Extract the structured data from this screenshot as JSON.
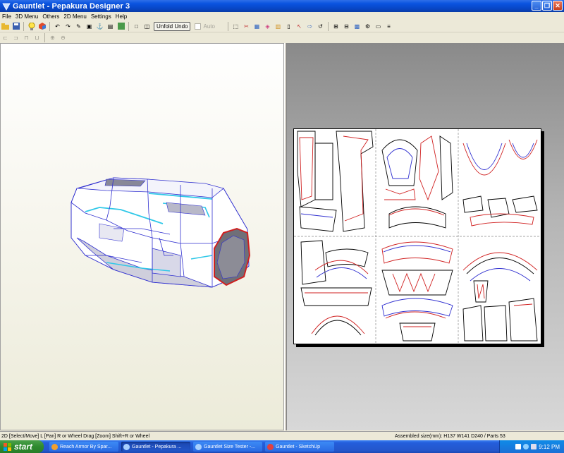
{
  "window": {
    "title": "Gauntlet - Pepakura Designer 3"
  },
  "menu": {
    "items": [
      "File",
      "3D Menu",
      "Others",
      "2D Menu",
      "Settings",
      "Help"
    ]
  },
  "toolbar": {
    "unfold_undo_label": "Unfold Undo",
    "auto_label": "Auto"
  },
  "status": {
    "left": "2D [Select/Move] L [Pan] R or Wheel Drag [Zoom] Shift+R or Wheel",
    "right": "Assembled size(mm): H137 W141 D240 / Parts 53"
  },
  "taskbar": {
    "start_label": "start",
    "tasks": [
      {
        "label": "Reach Armor By Spar...",
        "icon": "browser-icon"
      },
      {
        "label": "Gauntlet - Pepakura ...",
        "icon": "pepakura-icon",
        "active": true
      },
      {
        "label": "Gauntlet Size Tester -...",
        "icon": "pepakura-icon"
      },
      {
        "label": "Gauntlet - SketchUp",
        "icon": "sketchup-icon"
      }
    ],
    "clock": "9:12 PM"
  },
  "colors": {
    "accent": "#0a54e0",
    "model_edge": "#3030d0",
    "cut_edge": "#d02020"
  }
}
